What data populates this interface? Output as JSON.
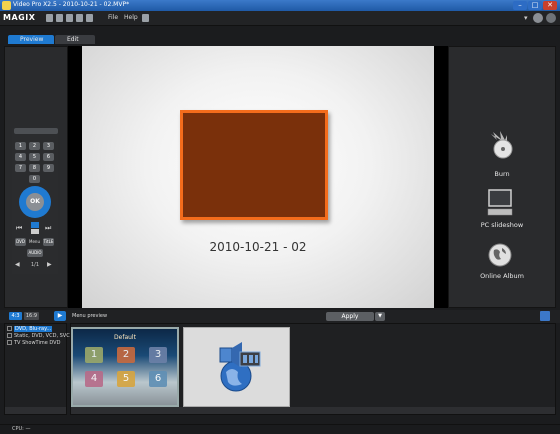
{
  "window": {
    "title": "Video Pro X2.5 - 2010-10-21 - 02.MVP*",
    "minimize": "–",
    "maximize": "□",
    "close": "✕"
  },
  "menubar": {
    "logo": "MAGIX",
    "menus": [
      "File",
      "Help"
    ]
  },
  "tabs": [
    {
      "label": "Preview",
      "active": true
    },
    {
      "label": "Edit",
      "active": false
    }
  ],
  "remote": {
    "keys": [
      "1",
      "2",
      "3",
      "4",
      "5",
      "6",
      "7",
      "8",
      "9",
      "0"
    ],
    "ok": "OK",
    "small_labels": [
      "DVD",
      "Menu",
      "TitLE"
    ],
    "audio": "AUDIO",
    "page": "1/1"
  },
  "preview": {
    "title_text": "2010-10-21 - 02"
  },
  "right_actions": [
    {
      "label": "Burn",
      "icon": "burn-disc-icon"
    },
    {
      "label": "PC slideshow",
      "icon": "computer-icon"
    },
    {
      "label": "Online Album",
      "icon": "globe-icon"
    }
  ],
  "bottom_toolbar": {
    "ratio_options": [
      "4:3",
      "16:9"
    ],
    "ratio_selected": "4:3",
    "menu_preview_label": "Menu preview",
    "apply_label": "Apply"
  },
  "tree": {
    "items": [
      "DVD, Blu-ray...",
      "Static, DVD, VCD, SVCD",
      "TV ShowTime DVD"
    ],
    "selected": 0
  },
  "templates": [
    {
      "title": "Default",
      "buttons": [
        "1",
        "2",
        "3",
        "4",
        "5",
        "6"
      ]
    },
    {
      "title": "",
      "icon": "audio-video-globe-icon"
    }
  ],
  "status": {
    "cpu": "CPU: —"
  },
  "colors": {
    "title_bar": "#2a6bbd",
    "accent_blue": "#1f7ad1",
    "preview_frame_orange": "#f46c1c",
    "preview_frame_fill": "#7a300b"
  }
}
